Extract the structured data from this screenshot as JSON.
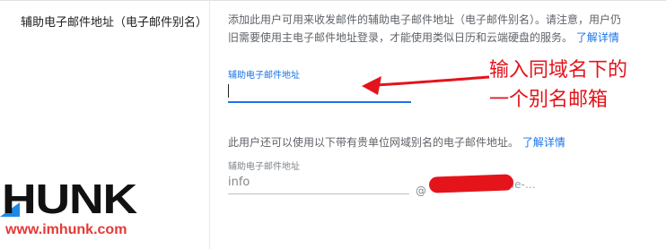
{
  "section": {
    "label": "辅助电子邮件地址（电子邮件别名）",
    "description": "添加此用户可用来收发邮件的辅助电子邮件地址（电子邮件别名）。请注意，用户仍旧需要使用主电子邮件地址登录，才能使用类似日历和云端硬盘的服务。",
    "learn_more": "了解详情"
  },
  "alias_field": {
    "label": "辅助电子邮件地址",
    "value": ""
  },
  "annotation": {
    "line1": "输入同域名下的",
    "line2": "一个别名邮箱",
    "color": "#e3141b"
  },
  "domain_alias": {
    "description": "此用户还可以使用以下带有贵单位网域别名的电子邮件地址。",
    "learn_more": "了解详情",
    "field_label": "辅助电子邮件地址",
    "value": "info",
    "at": "@",
    "domain": "…m.test-google-…"
  },
  "watermark": {
    "logo_text": "HUNK",
    "site": "www.imhunk.com"
  },
  "colors": {
    "accent": "#1a73e8",
    "annotation_red": "#e3141b"
  }
}
